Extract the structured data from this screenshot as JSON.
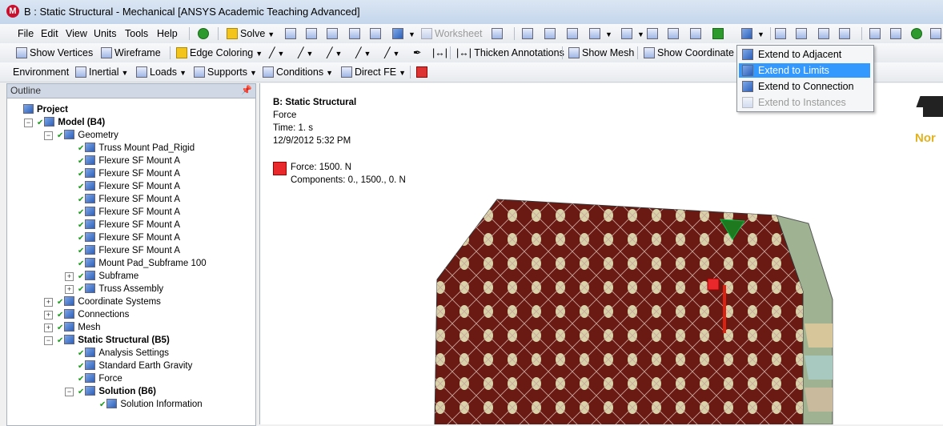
{
  "window": {
    "title": "B : Static Structural - Mechanical [ANSYS Academic Teaching Advanced]"
  },
  "menubar": {
    "items": [
      "File",
      "Edit",
      "View",
      "Units",
      "Tools",
      "Help"
    ],
    "solve": "Solve",
    "worksheet": "Worksheet"
  },
  "toolbar2": {
    "show_vertices": "Show Vertices",
    "wireframe": "Wireframe",
    "edge_coloring": "Edge Coloring",
    "thicken_annotations": "Thicken Annotations",
    "show_mesh": "Show Mesh",
    "show_coordinate": "Show Coordinate S"
  },
  "toolbar3": {
    "environment": "Environment",
    "inertial": "Inertial",
    "loads": "Loads",
    "supports": "Supports",
    "conditions": "Conditions",
    "direct_fe": "Direct FE"
  },
  "outline": {
    "header": "Outline",
    "tree": [
      {
        "label": "Project",
        "bold": true
      },
      {
        "label": "Model (B4)",
        "bold": true
      },
      {
        "label": "Geometry"
      },
      {
        "label": "Truss Mount Pad_Rigid"
      },
      {
        "label": "Flexure SF Mount A"
      },
      {
        "label": "Flexure SF Mount A"
      },
      {
        "label": "Flexure SF Mount A"
      },
      {
        "label": "Flexure SF Mount A"
      },
      {
        "label": "Flexure SF Mount A"
      },
      {
        "label": "Flexure SF Mount A"
      },
      {
        "label": "Flexure SF Mount A"
      },
      {
        "label": "Flexure SF Mount A"
      },
      {
        "label": "Mount Pad_Subframe 100"
      },
      {
        "label": "Subframe"
      },
      {
        "label": "Truss Assembly"
      },
      {
        "label": "Coordinate Systems"
      },
      {
        "label": "Connections"
      },
      {
        "label": "Mesh"
      },
      {
        "label": "Static Structural (B5)",
        "bold": true
      },
      {
        "label": "Analysis Settings"
      },
      {
        "label": "Standard Earth Gravity"
      },
      {
        "label": "Force"
      },
      {
        "label": "Solution (B6)",
        "bold": true
      },
      {
        "label": "Solution Information"
      }
    ]
  },
  "viewport": {
    "title": "B: Static Structural",
    "subtitle": "Force",
    "time": "Time: 1. s",
    "date": "12/9/2012 5:32 PM",
    "force_label": "Force: 1500. N",
    "components": "Components: 0., 1500., 0. N",
    "brand": "Nor"
  },
  "extend_menu": {
    "items": [
      {
        "label": "Extend to Adjacent"
      },
      {
        "label": "Extend to Limits"
      },
      {
        "label": "Extend to Connection"
      },
      {
        "label": "Extend to Instances"
      }
    ]
  },
  "colors": {
    "model_face": "#6a1a12",
    "selection": "#3399ff",
    "force_marker": "#e8282a"
  }
}
